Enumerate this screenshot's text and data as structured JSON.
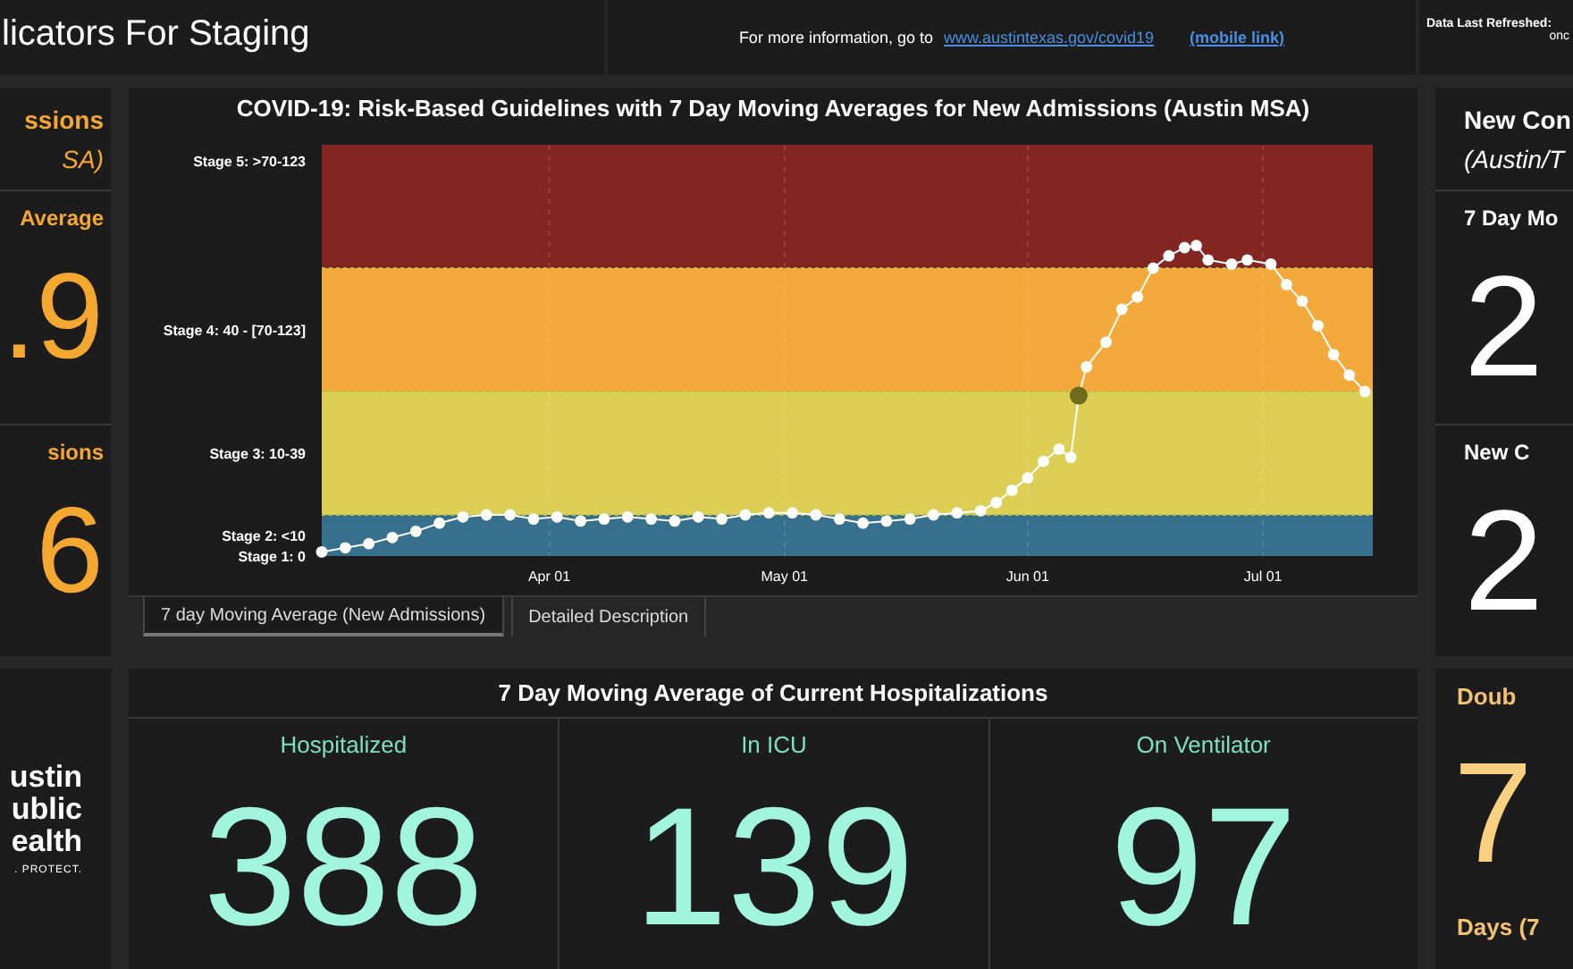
{
  "header": {
    "title": "licators For Staging",
    "info_text": "For more information, go to",
    "links": [
      "www.austintexas.gov/covid19",
      "(mobile link)"
    ],
    "refreshed_label": "Data Last Refreshed:",
    "refreshed_value": "onc"
  },
  "left_panel": {
    "title": "ssions",
    "subtitle": "SA)",
    "metrics": [
      {
        "label": "Average",
        "value": ".9"
      },
      {
        "label": "sions",
        "value": "6"
      }
    ]
  },
  "chart_panel": {
    "title": "COVID-19: Risk-Based Guidelines with 7 Day Moving Averages for New Admissions (Austin MSA)",
    "stage_labels": [
      "Stage 5: >70-123",
      "Stage 4: 40 - [70-123]",
      "Stage 3: 10-39",
      "Stage 2: <10",
      "Stage 1: 0"
    ],
    "month_labels": [
      "Apr 01",
      "May 01",
      "Jun 01",
      "Jul 01"
    ],
    "tabs": [
      {
        "label": "7 day Moving Average (New Admissions)",
        "selected": true
      },
      {
        "label": "Detailed Description",
        "selected": false
      }
    ]
  },
  "right_panel": {
    "title": "New Con",
    "subtitle": "(Austin/T",
    "metrics": [
      {
        "label": "7 Day Mo",
        "value": "2"
      },
      {
        "label": "New C",
        "value": "2"
      }
    ]
  },
  "logo": {
    "lines": [
      "ustin",
      "ublic",
      "ealth"
    ],
    "tagline": ". PROTECT."
  },
  "hospitalizations": {
    "title": "7 Day Moving Average of Current Hospitalizations",
    "metrics": [
      {
        "label": "Hospitalized",
        "value": "388"
      },
      {
        "label": "In ICU",
        "value": "139"
      },
      {
        "label": "On Ventilator",
        "value": "97"
      }
    ]
  },
  "doubling_panel": {
    "title": "Doub",
    "value": "7",
    "caption": "Days (7"
  }
}
